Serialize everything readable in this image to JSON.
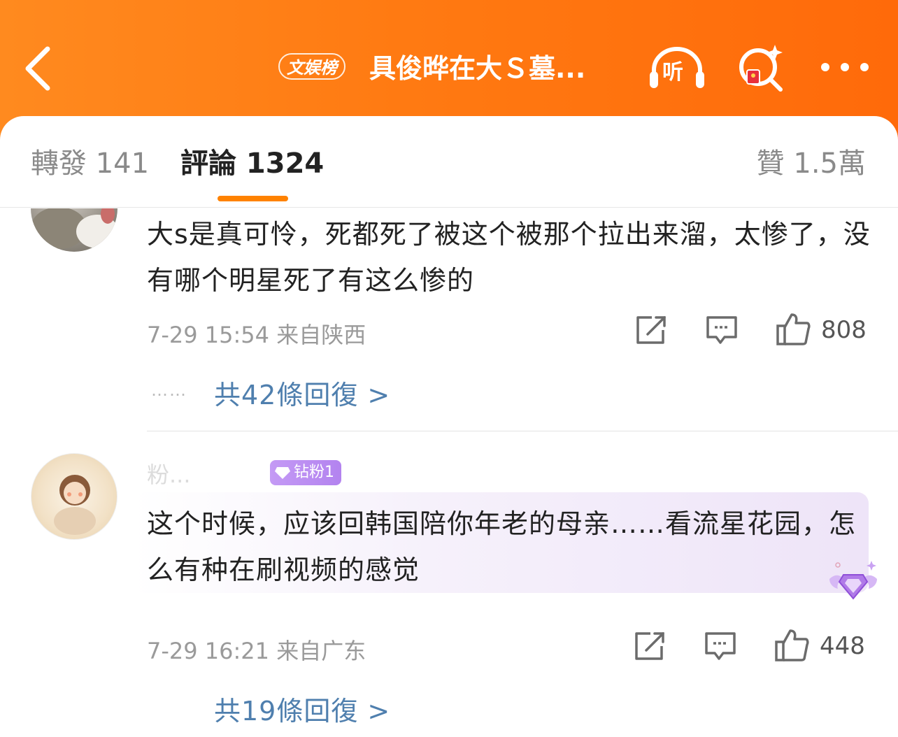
{
  "header": {
    "badge": "文娱榜",
    "title": "具俊晔在大Ｓ墓...",
    "listen_label": "听"
  },
  "tabs": {
    "repost": "轉發 141",
    "comment": "評論 1324",
    "like": "贊 1.5萬"
  },
  "comments": [
    {
      "text": "大s是真可怜，死都死了被这个被那个拉出来溜，太惨了，没有哪个明星死了有这么惨的",
      "meta": "7-29 15:54  来自陕西",
      "likes": "808",
      "dots": "……",
      "replies": "共42條回復 >"
    },
    {
      "username": "粉...",
      "fan_badge": "钻粉1",
      "text": "这个时候，应该回韩国陪你年老的母亲……看流星花园，怎么有种在刷视频的感觉",
      "meta": "7-29 16:21  来自广东",
      "likes": "448",
      "replies": "共19條回復 >"
    }
  ],
  "colors": {
    "header_orange": "#ff7a12",
    "tab_underline": "#ff8200",
    "link_blue": "#4f7fae",
    "fan_badge_purple": "#b383ef"
  }
}
